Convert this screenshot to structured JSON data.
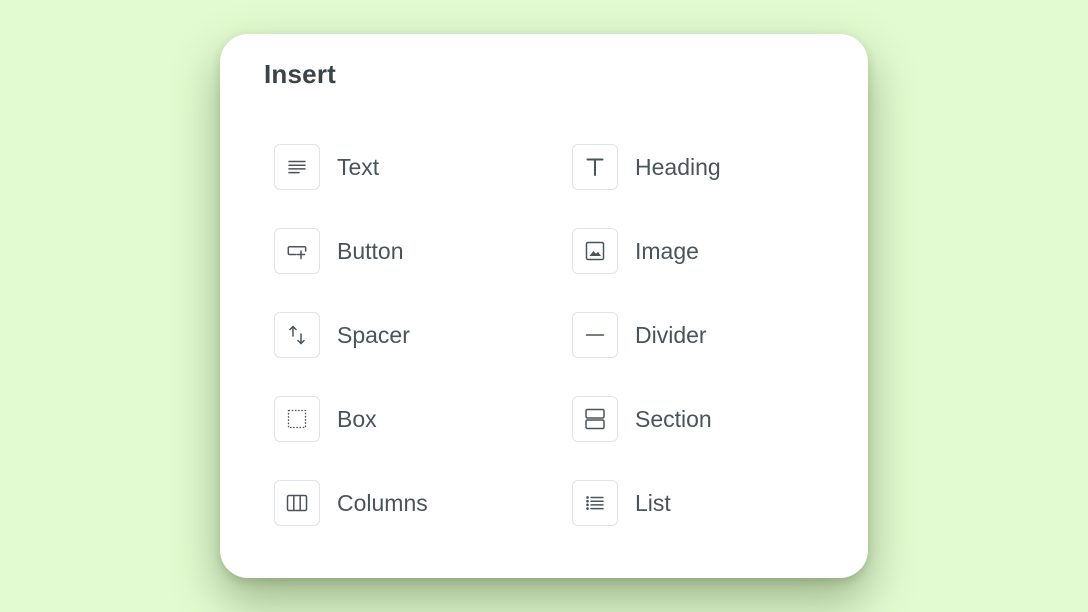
{
  "panel": {
    "title": "Insert",
    "items": [
      {
        "label": "Text",
        "icon": "text-align-left-icon"
      },
      {
        "label": "Heading",
        "icon": "heading-t-icon"
      },
      {
        "label": "Button",
        "icon": "button-cursor-icon"
      },
      {
        "label": "Image",
        "icon": "image-icon"
      },
      {
        "label": "Spacer",
        "icon": "spacer-arrows-icon"
      },
      {
        "label": "Divider",
        "icon": "divider-line-icon"
      },
      {
        "label": "Box",
        "icon": "dashed-box-icon"
      },
      {
        "label": "Section",
        "icon": "section-icon"
      },
      {
        "label": "Columns",
        "icon": "columns-icon"
      },
      {
        "label": "List",
        "icon": "list-icon"
      }
    ]
  },
  "colors": {
    "background": "#e2fbd0",
    "panel": "#ffffff",
    "text": "#4b5458",
    "title": "#394348",
    "icon_border": "#e1e4e6"
  }
}
